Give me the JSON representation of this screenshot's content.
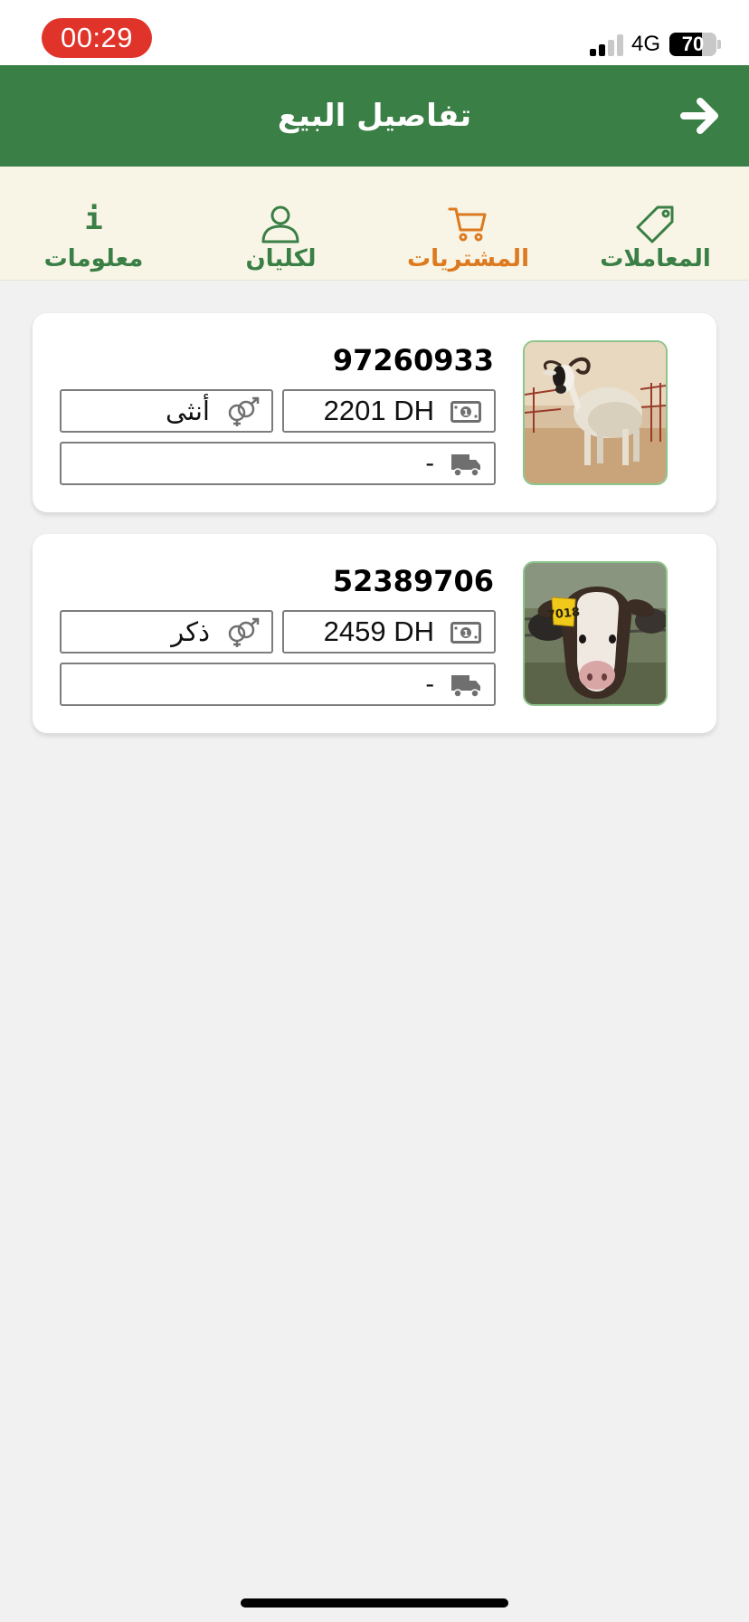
{
  "status_bar": {
    "time": "00:29",
    "network": "4G",
    "battery": "70",
    "battery_level": 0.7,
    "signal_bars_active": 2,
    "signal_bars_total": 4
  },
  "header": {
    "title": "تفاصيل البيع",
    "back_icon": "arrow-right-icon",
    "background": "#3a7f45"
  },
  "tabs": [
    {
      "label": "المعاملات",
      "icon": "tag-icon",
      "active": false
    },
    {
      "label": "المشتريات",
      "icon": "cart-icon",
      "active": true
    },
    {
      "label": "لكليان",
      "icon": "user-icon",
      "active": false
    },
    {
      "label": "معلومات",
      "icon": "info-icon",
      "glyph": "i",
      "active": false
    }
  ],
  "colors": {
    "accent_green": "#3a7f45",
    "active_orange": "#dd7a1f",
    "tab_background": "#f8f5e6"
  },
  "listings": [
    {
      "id": "97260933",
      "price": "2201 DH",
      "gender": "أنثى",
      "delivery": "-",
      "photo": "sheep-photo"
    },
    {
      "id": "52389706",
      "price": "2459 DH",
      "gender": "ذكر",
      "delivery": "-",
      "photo": "calf-photo",
      "ear_tag": "7018"
    }
  ]
}
